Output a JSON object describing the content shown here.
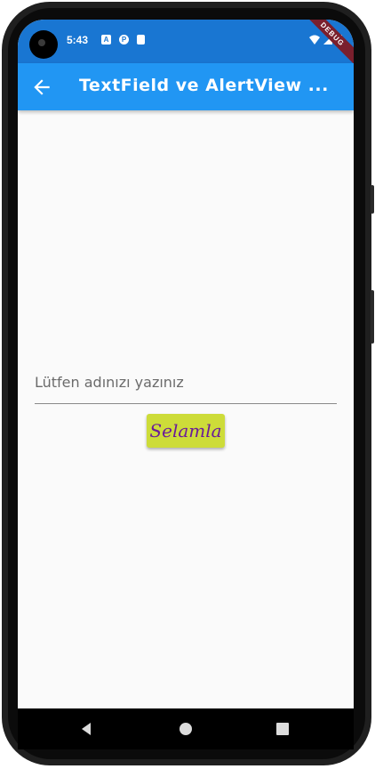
{
  "status_bar": {
    "time": "5:43",
    "icons": [
      "a-notification-icon",
      "p-notification-icon",
      "sd-card-icon"
    ],
    "right_icons": [
      "wifi-icon",
      "signal-icon",
      "battery-icon"
    ],
    "debug_label": "DEBUG",
    "color": "#1976d2"
  },
  "app_bar": {
    "title": "TextField ve AlertView ...",
    "back_icon": "arrow-back-icon",
    "color": "#2196f3"
  },
  "form": {
    "input_placeholder": "Lütfen adınızı yazınız",
    "input_value": "",
    "button_label": "Selamla",
    "button_color": "#cddc39",
    "button_text_color": "#6a1b9a"
  },
  "nav_bar": {
    "back": "nav-back-icon",
    "home": "nav-home-icon",
    "recents": "nav-recents-icon"
  }
}
